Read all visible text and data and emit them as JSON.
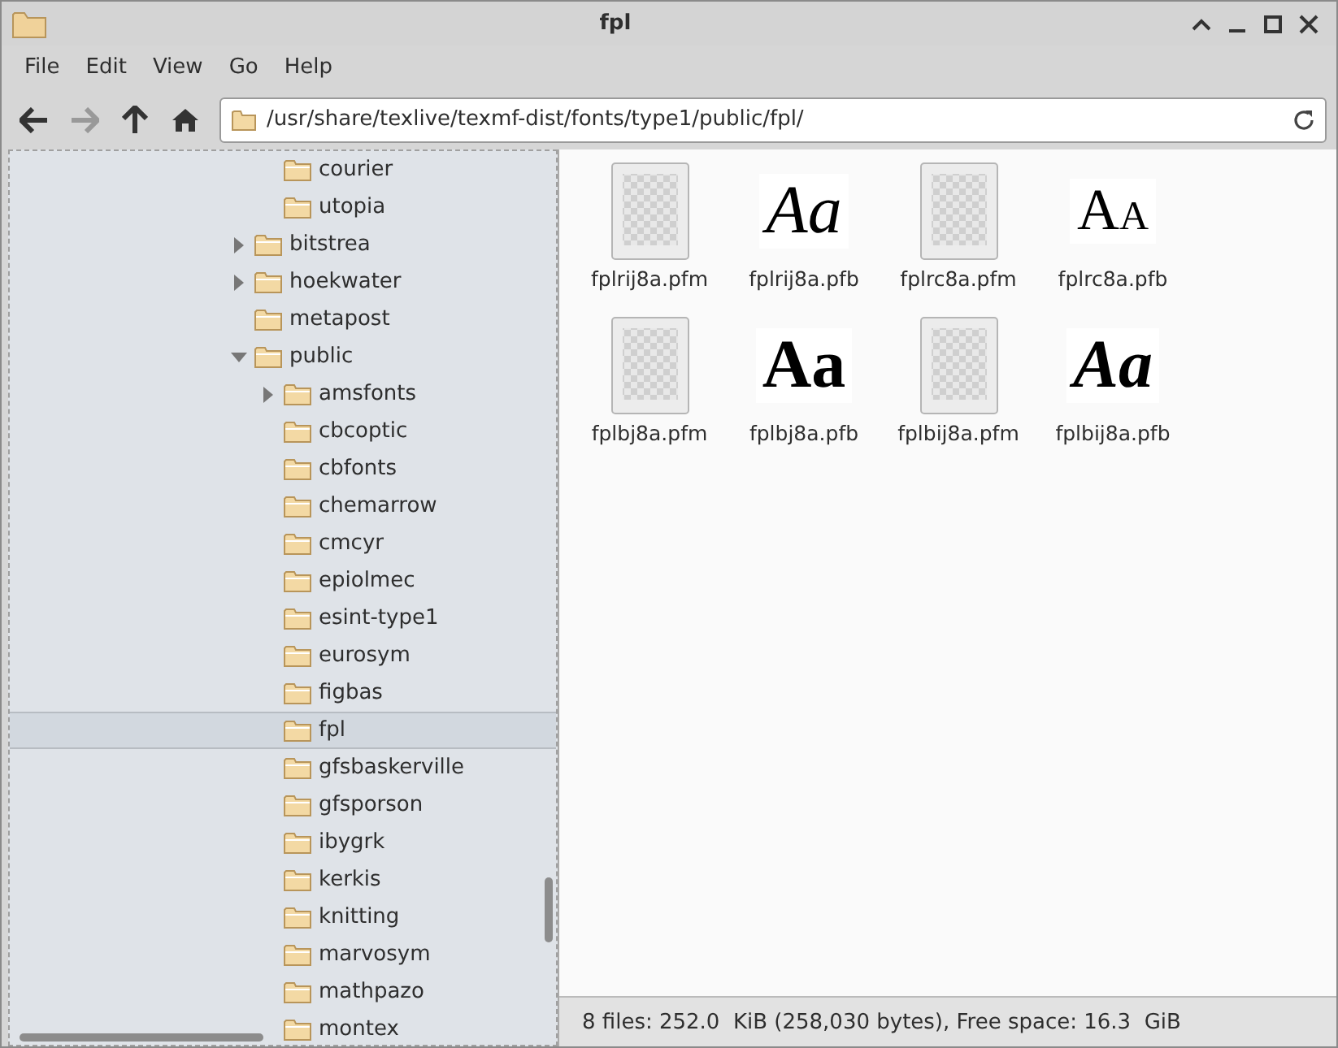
{
  "window": {
    "title": "fpl"
  },
  "menu": [
    "File",
    "Edit",
    "View",
    "Go",
    "Help"
  ],
  "toolbar": {
    "back_disabled": false,
    "forward_disabled": true,
    "path": "/usr/share/texlive/texmf-dist/fonts/type1/public/fpl/"
  },
  "tree": {
    "clipped_children": [
      {
        "label": "courier",
        "expandable": false,
        "expanded": false,
        "selected": false
      },
      {
        "label": "utopia",
        "expandable": false,
        "expanded": false,
        "selected": false
      }
    ],
    "items": [
      {
        "label": "bitstrea",
        "expandable": true,
        "expanded": false,
        "selected": false
      },
      {
        "label": "hoekwater",
        "expandable": true,
        "expanded": false,
        "selected": false
      },
      {
        "label": "metapost",
        "expandable": false,
        "expanded": false,
        "selected": false
      },
      {
        "label": "public",
        "expandable": true,
        "expanded": true,
        "selected": false,
        "children": [
          {
            "label": "amsfonts",
            "expandable": true,
            "expanded": false,
            "selected": false
          },
          {
            "label": "cbcoptic",
            "expandable": false,
            "expanded": false,
            "selected": false
          },
          {
            "label": "cbfonts",
            "expandable": false,
            "expanded": false,
            "selected": false
          },
          {
            "label": "chemarrow",
            "expandable": false,
            "expanded": false,
            "selected": false
          },
          {
            "label": "cmcyr",
            "expandable": false,
            "expanded": false,
            "selected": false
          },
          {
            "label": "epiolmec",
            "expandable": false,
            "expanded": false,
            "selected": false
          },
          {
            "label": "esint-type1",
            "expandable": false,
            "expanded": false,
            "selected": false
          },
          {
            "label": "eurosym",
            "expandable": false,
            "expanded": false,
            "selected": false
          },
          {
            "label": "figbas",
            "expandable": false,
            "expanded": false,
            "selected": false
          },
          {
            "label": "fpl",
            "expandable": false,
            "expanded": false,
            "selected": true
          },
          {
            "label": "gfsbaskerville",
            "expandable": false,
            "expanded": false,
            "selected": false
          },
          {
            "label": "gfsporson",
            "expandable": false,
            "expanded": false,
            "selected": false
          },
          {
            "label": "ibygrk",
            "expandable": false,
            "expanded": false,
            "selected": false
          },
          {
            "label": "kerkis",
            "expandable": false,
            "expanded": false,
            "selected": false
          },
          {
            "label": "knitting",
            "expandable": false,
            "expanded": false,
            "selected": false
          },
          {
            "label": "marvosym",
            "expandable": false,
            "expanded": false,
            "selected": false
          },
          {
            "label": "mathpazo",
            "expandable": false,
            "expanded": false,
            "selected": false
          },
          {
            "label": "montex",
            "expandable": false,
            "expanded": false,
            "selected": false
          }
        ]
      }
    ]
  },
  "files": [
    {
      "name": "fplrij8a.pfm",
      "kind": "blank"
    },
    {
      "name": "fplrij8a.pfb",
      "kind": "italic",
      "preview": "Aa"
    },
    {
      "name": "fplrc8a.pfm",
      "kind": "blank"
    },
    {
      "name": "fplrc8a.pfb",
      "kind": "smallcaps",
      "preview": "Aa"
    },
    {
      "name": "fplbj8a.pfm",
      "kind": "blank"
    },
    {
      "name": "fplbj8a.pfb",
      "kind": "bold",
      "preview": "Aa"
    },
    {
      "name": "fplbij8a.pfm",
      "kind": "blank"
    },
    {
      "name": "fplbij8a.pfb",
      "kind": "bolditalic",
      "preview": "Aa"
    }
  ],
  "status_bar": "8 files: 252.0  KiB (258,030 bytes), Free space: 16.3  GiB"
}
